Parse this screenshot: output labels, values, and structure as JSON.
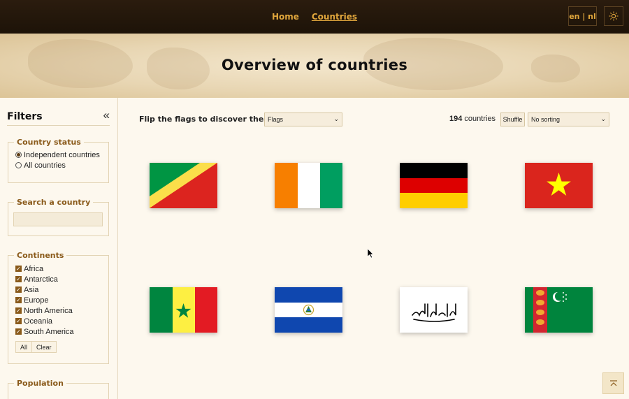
{
  "nav": {
    "home": "Home",
    "countries": "Countries",
    "lang": "en | nl",
    "theme_icon": "sun-icon"
  },
  "hero": {
    "title": "Overview of countries"
  },
  "sidebar": {
    "title": "Filters",
    "collapse": "«",
    "status": {
      "legend": "Country status",
      "options": [
        "Independent countries",
        "All countries"
      ],
      "selected": "Independent countries"
    },
    "search": {
      "legend": "Search a country",
      "placeholder": ""
    },
    "continents": {
      "legend": "Continents",
      "items": [
        "Africa",
        "Antarctica",
        "Asia",
        "Europe",
        "North America",
        "Oceania",
        "South America"
      ],
      "all": "All",
      "clear": "Clear"
    },
    "population": {
      "legend": "Population"
    }
  },
  "toolbar": {
    "flip_label": "Flip the flags to discover the country",
    "mode": "Flags",
    "count": "194",
    "count_suffix": "countries",
    "shuffle": "Shuffle",
    "sort": "No sorting"
  },
  "flags": [
    "Republic of the Congo",
    "Côte d'Ivoire",
    "Germany",
    "Vietnam",
    "Senegal",
    "El Salvador",
    "Afghanistan",
    "Turkmenistan"
  ],
  "colors": {
    "accent": "#e0a63c",
    "brown": "#8a5a1a",
    "nav_bg": "#2b1c0e",
    "page_bg": "#fdf8ee"
  }
}
